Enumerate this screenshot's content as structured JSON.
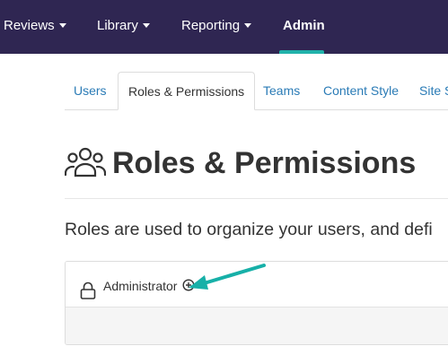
{
  "topnav": {
    "items": [
      {
        "label": "Reviews",
        "dropdown": true
      },
      {
        "label": "Library",
        "dropdown": true
      },
      {
        "label": "Reporting",
        "dropdown": true
      },
      {
        "label": "Admin",
        "dropdown": false,
        "active": true
      }
    ],
    "background": "#2f2652",
    "accent": "#20b2aa"
  },
  "tabs": {
    "items": [
      {
        "label": "Users"
      },
      {
        "label": "Roles & Permissions",
        "active": true
      },
      {
        "label": "Teams"
      },
      {
        "label": "Content Style"
      },
      {
        "label": "Site S"
      }
    ]
  },
  "page": {
    "title": "Roles & Permissions",
    "title_icon": "users-icon",
    "description": "Roles are used to organize your users, and defi"
  },
  "role_panel": {
    "role_name": "Administrator",
    "lock_icon": "lock-icon",
    "info_icon": "info-circle-icon"
  },
  "annotation": {
    "icon": "arrow-icon",
    "color": "#17b0a8"
  }
}
